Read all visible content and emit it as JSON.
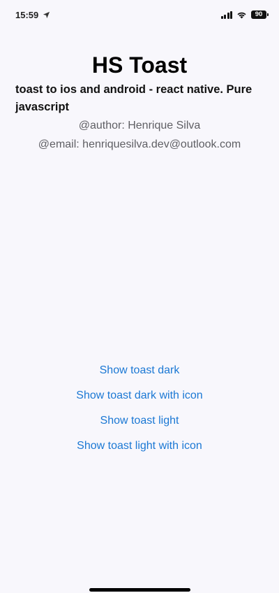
{
  "status_bar": {
    "time": "15:59",
    "battery": "90",
    "icons": [
      "location-arrow-icon",
      "cellular-signal-icon",
      "wifi-icon",
      "battery-icon"
    ]
  },
  "header": {
    "title": "HS Toast",
    "subtitle": "toast to ios and android - react native. Pure javascript",
    "author": "@author: Henrique Silva",
    "email": "@email: henriquesilva.dev@outlook.com"
  },
  "actions": [
    {
      "label": "Show toast dark"
    },
    {
      "label": "Show toast dark with icon"
    },
    {
      "label": "Show toast light"
    },
    {
      "label": "Show toast light with icon"
    }
  ],
  "colors": {
    "background": "#f8f7fc",
    "link": "#1b78d4",
    "meta_text": "#5f5f64"
  }
}
